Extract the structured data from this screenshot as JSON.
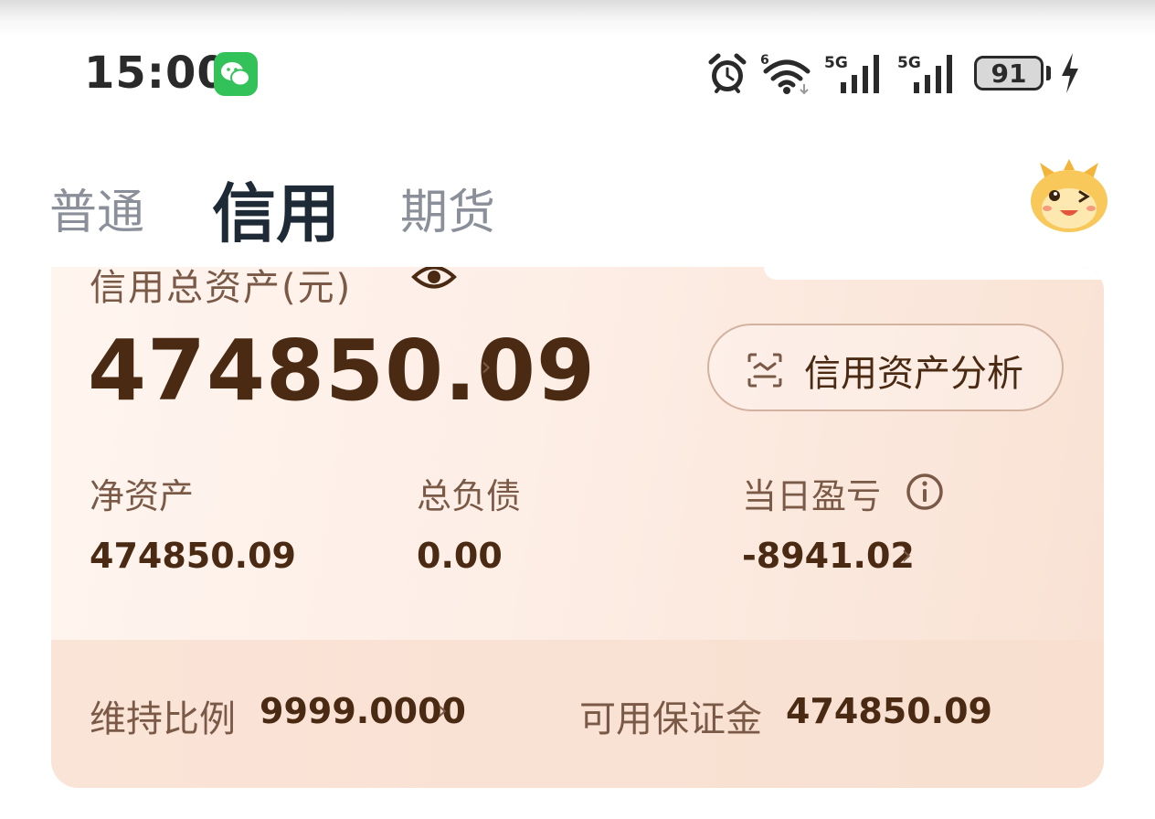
{
  "status_bar": {
    "time": "15:00",
    "battery_level": "91",
    "signal_1_label": "5G",
    "signal_2_label": "5G",
    "wifi_badge": "6",
    "icons": [
      "wechat-icon",
      "alarm-icon",
      "wifi-icon",
      "signal-icon",
      "signal-icon",
      "battery-icon",
      "charging-icon"
    ]
  },
  "tabs": [
    {
      "label": "普通",
      "active": false
    },
    {
      "label": "信用",
      "active": true
    },
    {
      "label": "期货",
      "active": false
    }
  ],
  "card": {
    "title": "信用总资产(元)",
    "total_assets": "474850.09",
    "analysis_button": "信用资产分析",
    "metrics": [
      {
        "label": "净资产",
        "value": "474850.09"
      },
      {
        "label": "总负债",
        "value": "0.00"
      },
      {
        "label": "当日盈亏",
        "value": "-8941.02"
      }
    ],
    "maintenance_ratio_label": "维持比例",
    "maintenance_ratio_value": "9999.0000",
    "available_margin_label": "可用保证金",
    "available_margin_value": "474850.09"
  },
  "colors": {
    "primary_text": "#4a2a12",
    "secondary_text": "#7a5a47",
    "tab_active": "#1e2a36",
    "tab_inactive": "#8a8f99",
    "card_bg": "#fbe8de",
    "wechat_green": "#33c15a"
  }
}
